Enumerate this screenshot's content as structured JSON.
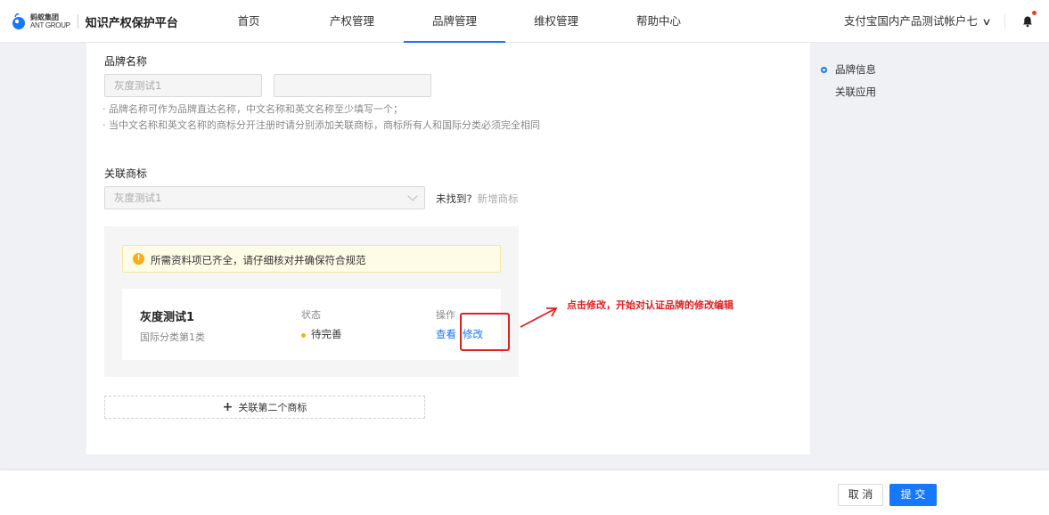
{
  "header": {
    "logo_cn": "蚂蚁集团",
    "logo_en": "ANT GROUP",
    "platform_name": "知识产权保护平台",
    "nav": [
      "首页",
      "产权管理",
      "品牌管理",
      "维权管理",
      "帮助中心"
    ],
    "active_nav": "品牌管理",
    "account_name": "支付宝国内产品测试帐户七"
  },
  "brand": {
    "section_label": "品牌名称",
    "cn_name_value": "灰度测试1",
    "en_name_value": "",
    "hint1": "· 品牌名称可作为品牌直达名称，中文名称和英文名称至少填写一个；",
    "hint2": "· 当中文名称和英文名称的商标分开注册时请分别添加关联商标，商标所有人和国际分类必须完全相同"
  },
  "trademark": {
    "section_label": "关联商标",
    "select_value": "灰度测试1",
    "not_found": "未找到?",
    "add_link": "新增商标",
    "alert": "所需资料项已齐全，请仔细核对并确保符合规范",
    "card": {
      "name": "灰度测试1",
      "class": "国际分类第1类",
      "status_label": "状态",
      "status_value": "待完善",
      "action_label": "操作",
      "view": "查看",
      "edit": "修改"
    },
    "add_second": "关联第二个商标"
  },
  "annotation": {
    "text": "点击修改，开始对认证品牌的修改编辑",
    "color": "#e02020"
  },
  "anchor": [
    "品牌信息",
    "关联应用"
  ],
  "footer": {
    "cancel": "取 消",
    "submit": "提 交"
  },
  "colors": {
    "primary": "#1677ff",
    "warning": "#faad14",
    "annotation": "#e02020"
  }
}
